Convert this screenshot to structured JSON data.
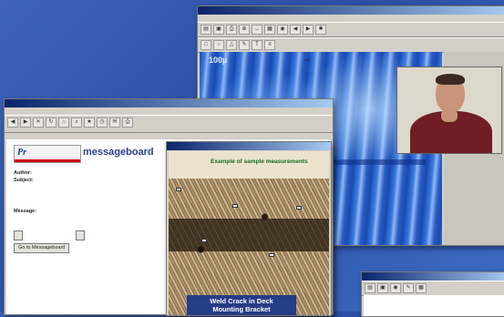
{
  "viewer": {
    "title": "",
    "scale_label": "100µ",
    "tag_label": "",
    "caption": ""
  },
  "board": {
    "title_label": "messageboard",
    "author_label": "Author:",
    "author_value": "",
    "subject_label": "Subject:",
    "message_label": "Message:",
    "message_text": "",
    "buttons": [
      "Go to Messageboard"
    ],
    "threads": []
  },
  "photo": {
    "header": "Example of sample measurements",
    "labels": [
      "",
      "",
      "",
      "",
      ""
    ],
    "weld_caption_1": "Weld Crack in Deck",
    "weld_caption_2": "Mounting Bracket"
  },
  "icons": {
    "video": "person-video-icon"
  }
}
